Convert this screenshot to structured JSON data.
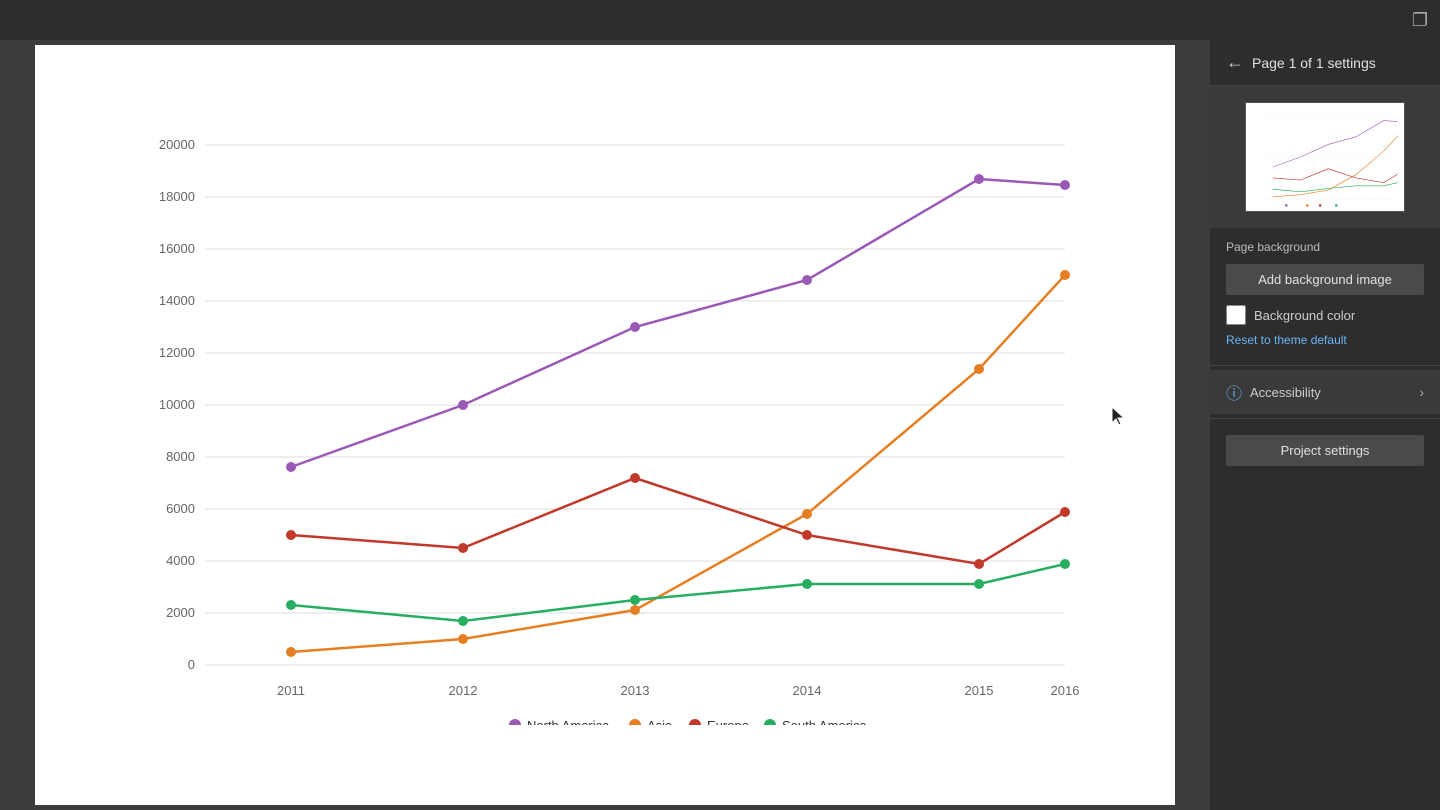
{
  "topbar": {
    "copy_icon": "❐"
  },
  "panel": {
    "back_icon": "←",
    "title": "Page 1 of 1 settings",
    "page_background_label": "Page background",
    "add_background_image_label": "Add background image",
    "background_color_label": "Background color",
    "reset_link_label": "Reset to theme default",
    "accessibility_label": "Accessibility",
    "project_settings_label": "Project settings"
  },
  "chart": {
    "title": "",
    "y_labels": [
      "0",
      "2000",
      "4000",
      "6000",
      "8000",
      "10000",
      "12000",
      "14000",
      "16000",
      "18000",
      "20000"
    ],
    "x_labels": [
      "2011",
      "2012",
      "2013",
      "2014",
      "2015",
      "2016"
    ],
    "series": [
      {
        "name": "North America",
        "color": "#9b59b6",
        "points": [
          7600,
          10000,
          13000,
          14800,
          18700,
          18400
        ]
      },
      {
        "name": "Asia",
        "color": "#e67e22",
        "points": [
          500,
          1000,
          2100,
          5800,
          11400,
          15000
        ]
      },
      {
        "name": "Europe",
        "color": "#c0392b",
        "points": [
          5000,
          4500,
          7200,
          5000,
          3900,
          5900
        ]
      },
      {
        "name": "South America",
        "color": "#27ae60",
        "points": [
          2300,
          1700,
          2500,
          3100,
          3100,
          3900
        ]
      }
    ]
  },
  "legend": [
    {
      "name": "North America",
      "color": "#9b59b6"
    },
    {
      "name": "Asia",
      "color": "#e67e22"
    },
    {
      "name": "Europe",
      "color": "#c0392b"
    },
    {
      "name": "South America",
      "color": "#27ae60"
    }
  ]
}
